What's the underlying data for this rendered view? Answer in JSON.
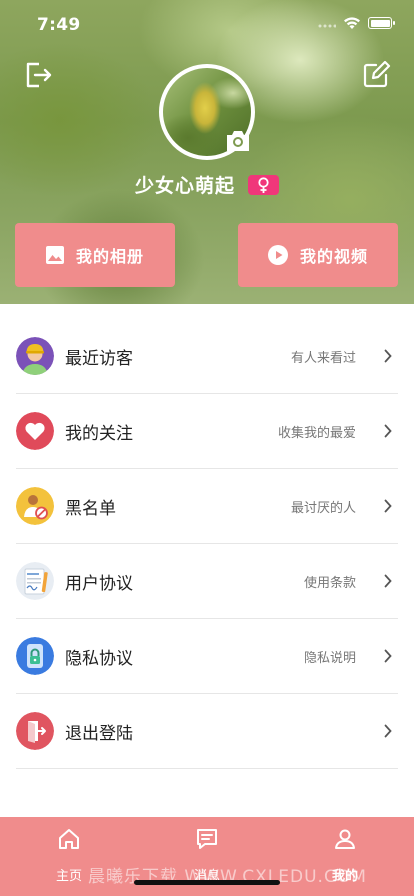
{
  "status_bar": {
    "time": "7:49"
  },
  "profile": {
    "username": "少女心萌起",
    "gender": "female"
  },
  "actions": {
    "album_label": "我的相册",
    "video_label": "我的视频"
  },
  "menu": [
    {
      "label": "最近访客",
      "hint": "有人来看过",
      "icon": "visitor-avatar-icon"
    },
    {
      "label": "我的关注",
      "hint": "收集我的最爱",
      "icon": "heart-icon"
    },
    {
      "label": "黑名单",
      "hint": "最讨厌的人",
      "icon": "blacklist-icon"
    },
    {
      "label": "用户协议",
      "hint": "使用条款",
      "icon": "agreement-document-icon"
    },
    {
      "label": "隐私协议",
      "hint": "隐私说明",
      "icon": "privacy-lock-icon"
    },
    {
      "label": "退出登陆",
      "hint": "",
      "icon": "exit-door-icon"
    }
  ],
  "tabs": [
    {
      "label": "主页",
      "icon": "home-icon"
    },
    {
      "label": "消息",
      "icon": "message-icon"
    },
    {
      "label": "我的",
      "icon": "user-icon"
    }
  ],
  "watermark": "晨曦乐下载 WWW.CXLEDU.COM",
  "colors": {
    "accent": "#f08c8c",
    "gender_badge": "#f0377a"
  }
}
